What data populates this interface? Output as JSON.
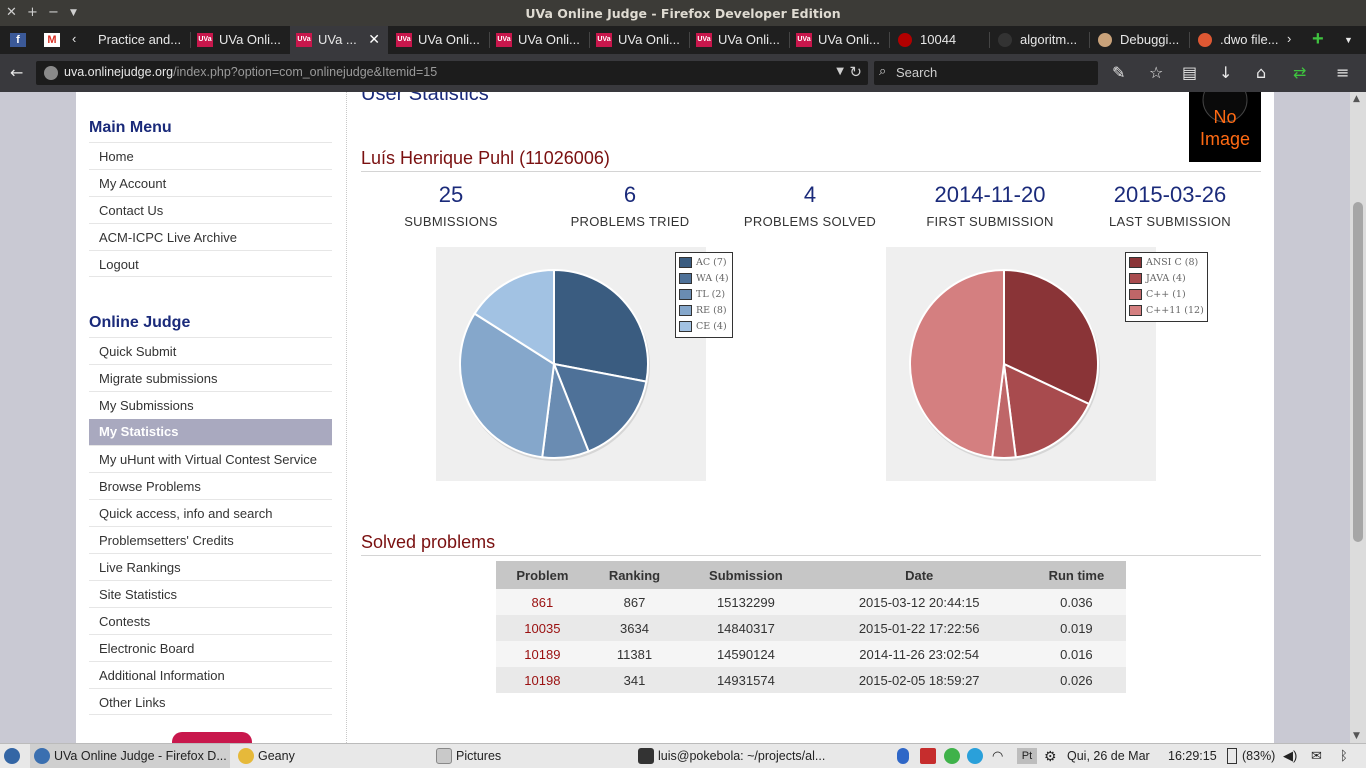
{
  "window": {
    "title": "UVa Online Judge - Firefox Developer Edition"
  },
  "tabs": [
    {
      "label": "Practice and...",
      "icon": "page-icon"
    },
    {
      "label": "UVa Onli...",
      "icon": "uva-icon"
    },
    {
      "label": "UVa ...",
      "icon": "uva-icon",
      "active": true
    },
    {
      "label": "UVa Onli...",
      "icon": "uva-icon"
    },
    {
      "label": "UVa Onli...",
      "icon": "uva-icon"
    },
    {
      "label": "UVa Onli...",
      "icon": "uva-icon"
    },
    {
      "label": "UVa Onli...",
      "icon": "uva-icon"
    },
    {
      "label": "UVa Onli...",
      "icon": "uva-icon"
    },
    {
      "label": "10044",
      "icon": "red-dot-icon"
    },
    {
      "label": "algoritm...",
      "icon": "github-icon"
    },
    {
      "label": "Debuggi...",
      "icon": "avatar-icon"
    },
    {
      "label": ".dwo file...",
      "icon": "duckduckgo-icon"
    }
  ],
  "navbar": {
    "url_domain": "uva.onlinejudge.org",
    "url_path": "/index.php?option=com_onlinejudge&Itemid=15",
    "search_placeholder": "Search"
  },
  "sidebar": {
    "main_menu_title": "Main Menu",
    "main_menu": [
      "Home",
      "My Account",
      "Contact Us",
      "ACM-ICPC Live Archive",
      "Logout"
    ],
    "online_judge_title": "Online Judge",
    "online_judge": [
      "Quick Submit",
      "Migrate submissions",
      "My Submissions",
      "My Statistics",
      "My uHunt with Virtual Contest Service",
      "Browse Problems",
      "Quick access, info and search",
      "Problemsetters' Credits",
      "Live Rankings",
      "Site Statistics",
      "Contests",
      "Electronic Board",
      "Additional Information",
      "Other Links"
    ],
    "active_item": "My Statistics"
  },
  "main": {
    "heading": "User Statistics",
    "no_image_line1": "No",
    "no_image_line2": "Image",
    "user_name": "Luís Henrique Puhl (11026006)",
    "stats": [
      {
        "value": "25",
        "label": "SUBMISSIONS"
      },
      {
        "value": "6",
        "label": "PROBLEMS TRIED"
      },
      {
        "value": "4",
        "label": "PROBLEMS SOLVED"
      },
      {
        "value": "2014-11-20",
        "label": "FIRST SUBMISSION"
      },
      {
        "value": "2015-03-26",
        "label": "LAST SUBMISSION"
      }
    ],
    "solved_title": "Solved problems",
    "table_headers": [
      "Problem",
      "Ranking",
      "Submission",
      "Date",
      "Run time"
    ],
    "table_rows": [
      [
        "861",
        "867",
        "15132299",
        "2015-03-12 20:44:15",
        "0.036"
      ],
      [
        "10035",
        "3634",
        "14840317",
        "2015-01-22 17:22:56",
        "0.019"
      ],
      [
        "10189",
        "11381",
        "14590124",
        "2014-11-26 23:02:54",
        "0.016"
      ],
      [
        "10198",
        "341",
        "14931574",
        "2015-02-05 18:59:27",
        "0.026"
      ]
    ]
  },
  "chart_data": [
    {
      "type": "pie",
      "legend": [
        "AC (7)",
        "WA (4)",
        "TL (2)",
        "RE (8)",
        "CE (4)"
      ],
      "categories": [
        "AC",
        "WA",
        "TL",
        "RE",
        "CE"
      ],
      "values": [
        7,
        4,
        2,
        8,
        4
      ],
      "colors": [
        "#3a5c80",
        "#4e7198",
        "#6a8cb2",
        "#85a7cb",
        "#a2c2e3"
      ],
      "legend_position": "top-right"
    },
    {
      "type": "pie",
      "legend": [
        "ANSI C (8)",
        "JAVA (4)",
        "C++ (1)",
        "C++11 (12)"
      ],
      "categories": [
        "ANSI C",
        "JAVA",
        "C++",
        "C++11"
      ],
      "values": [
        8,
        4,
        1,
        12
      ],
      "colors": [
        "#8a3437",
        "#a84b4e",
        "#bf6668",
        "#d47f80"
      ],
      "legend_position": "top-right"
    }
  ],
  "taskbar": {
    "items": [
      "UVa Online Judge - Firefox D...",
      "Geany",
      "Pictures",
      "luis@pokebola: ~/projects/al..."
    ],
    "keyboard": "Pt",
    "date": "Qui, 26 de Mar",
    "time": "16:29:15",
    "battery": "(83%)"
  }
}
